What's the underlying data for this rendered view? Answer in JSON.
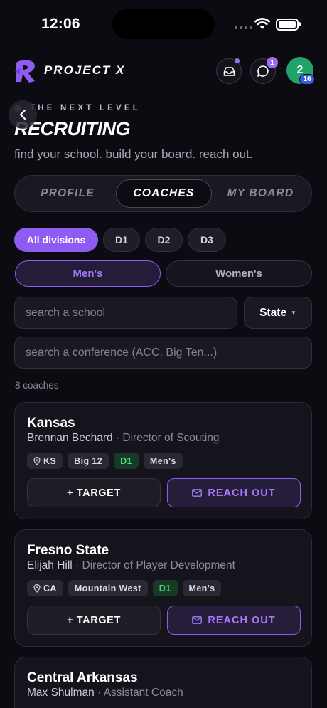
{
  "status_bar": {
    "time": "12:06"
  },
  "header": {
    "brand": "PROJECT X",
    "chat_badge": "1",
    "avatar_initial": "2",
    "avatar_badge": "16"
  },
  "hero": {
    "eyebrow": "THE NEXT LEVEL",
    "title": "RECRUITING",
    "subtitle": "find your school. build your board. reach out."
  },
  "tabs": [
    "PROFILE",
    "COACHES",
    "MY BOARD"
  ],
  "active_tab": "COACHES",
  "divisions": [
    "All divisions",
    "D1",
    "D2",
    "D3"
  ],
  "selected_division": "All divisions",
  "gender": [
    "Men's",
    "Women's"
  ],
  "selected_gender": "Men's",
  "filters": {
    "school_placeholder": "search a school",
    "state_label": "State",
    "conference_placeholder": "search a conference (ACC, Big Ten...)"
  },
  "result_count": "8 coaches",
  "coaches": [
    {
      "school": "Kansas",
      "name": "Brennan Bechard",
      "role": "Director of Scouting",
      "state": "KS",
      "conference": "Big 12",
      "division": "D1",
      "gender": "Men's"
    },
    {
      "school": "Fresno State",
      "name": "Elijah Hill",
      "role": "Director of Player Development",
      "state": "CA",
      "conference": "Mountain West",
      "division": "D1",
      "gender": "Men's"
    },
    {
      "school": "Central Arkansas",
      "name": "Max Shulman",
      "role": "Assistant Coach"
    }
  ],
  "actions": {
    "target_label": "+ TARGET",
    "reach_label": "REACH OUT"
  },
  "colors": {
    "background": "#0d0b12",
    "accent": "#8e5cf2",
    "avatar": "#22a36b",
    "d1_tag": "#4fd27a"
  }
}
